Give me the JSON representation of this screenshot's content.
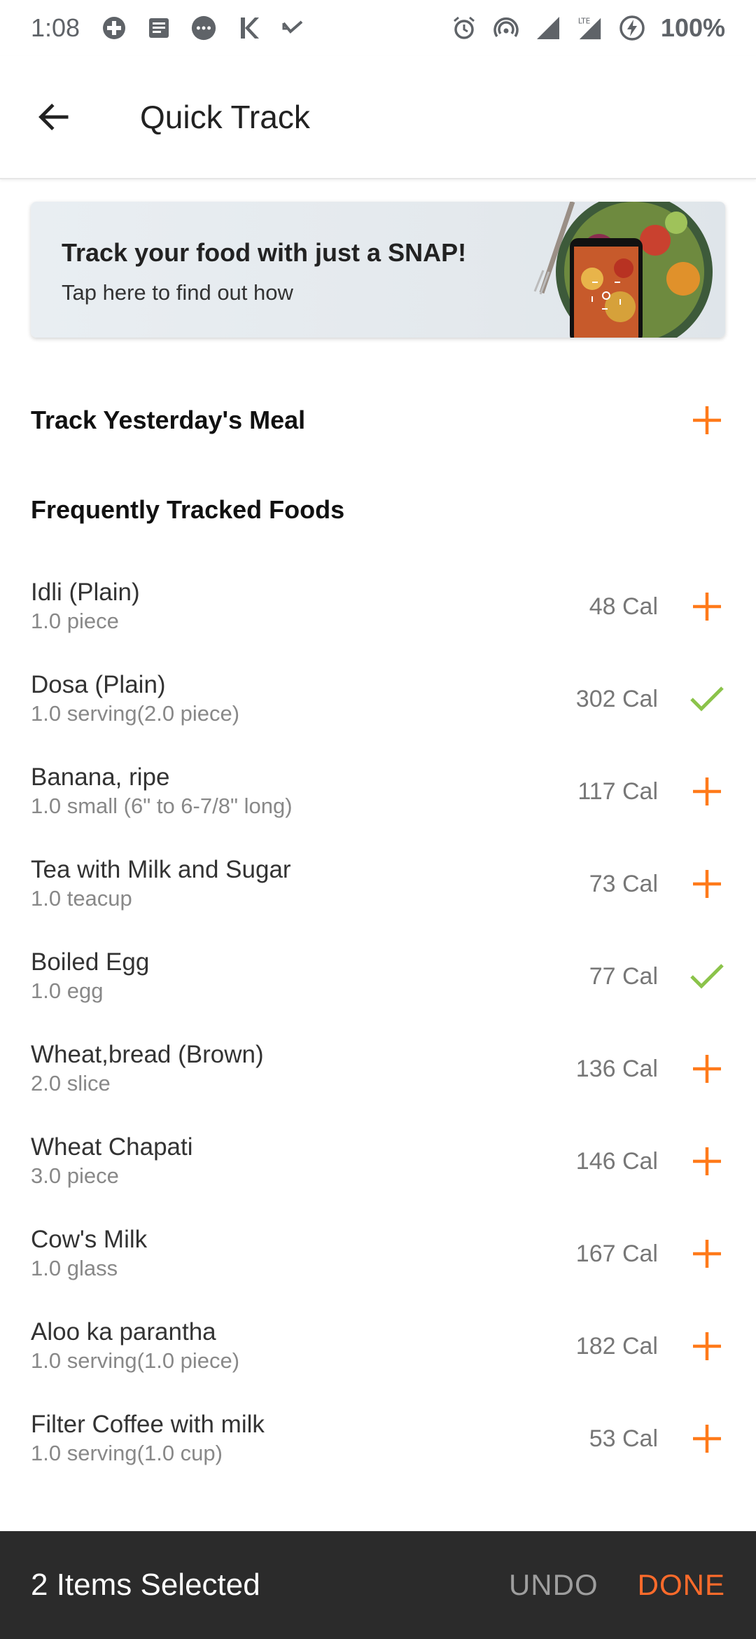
{
  "status_bar": {
    "time": "1:08",
    "battery": "100%",
    "left_icons": [
      "hospital-icon",
      "news-icon",
      "chat-icon",
      "k-icon",
      "missed-call-icon"
    ],
    "right_icons": [
      "alarm-icon",
      "hotspot-icon",
      "signal-icon",
      "lte-signal-icon",
      "battery-charging-icon"
    ]
  },
  "app_bar": {
    "title": "Quick Track",
    "back_icon": "arrow-back-icon"
  },
  "banner": {
    "title": "Track your food with just a SNAP!",
    "subtitle": "Tap here to find out how"
  },
  "yesterday": {
    "label": "Track Yesterday's Meal",
    "icon": "plus-icon"
  },
  "frequent": {
    "title": "Frequently Tracked Foods"
  },
  "foods": [
    {
      "name": "Idli (Plain)",
      "serving": "1.0 piece",
      "calories": "48 Cal",
      "selected": false
    },
    {
      "name": "Dosa (Plain)",
      "serving": "1.0 serving(2.0 piece)",
      "calories": "302 Cal",
      "selected": true
    },
    {
      "name": "Banana, ripe",
      "serving": "1.0 small (6\" to 6-7/8\" long)",
      "calories": "117 Cal",
      "selected": false
    },
    {
      "name": "Tea with Milk and Sugar",
      "serving": "1.0 teacup",
      "calories": "73 Cal",
      "selected": false
    },
    {
      "name": "Boiled Egg",
      "serving": "1.0 egg",
      "calories": "77 Cal",
      "selected": true
    },
    {
      "name": "Wheat,bread (Brown)",
      "serving": "2.0 slice",
      "calories": "136 Cal",
      "selected": false
    },
    {
      "name": "Wheat Chapati",
      "serving": "3.0 piece",
      "calories": "146 Cal",
      "selected": false
    },
    {
      "name": "Cow's Milk",
      "serving": "1.0 glass",
      "calories": "167 Cal",
      "selected": false
    },
    {
      "name": "Aloo ka parantha",
      "serving": "1.0 serving(1.0 piece)",
      "calories": "182 Cal",
      "selected": false
    },
    {
      "name": "Filter Coffee with milk",
      "serving": "1.0 serving(1.0 cup)",
      "calories": "53 Cal",
      "selected": false
    }
  ],
  "bottom_bar": {
    "selected_text": "2 Items Selected",
    "undo_label": "UNDO",
    "done_label": "DONE"
  },
  "colors": {
    "accent_orange": "#ff7a1a",
    "check_green": "#8bc34a",
    "bottom_bar_bg": "#2b2b2b",
    "done_orange": "#ff6b2b"
  }
}
